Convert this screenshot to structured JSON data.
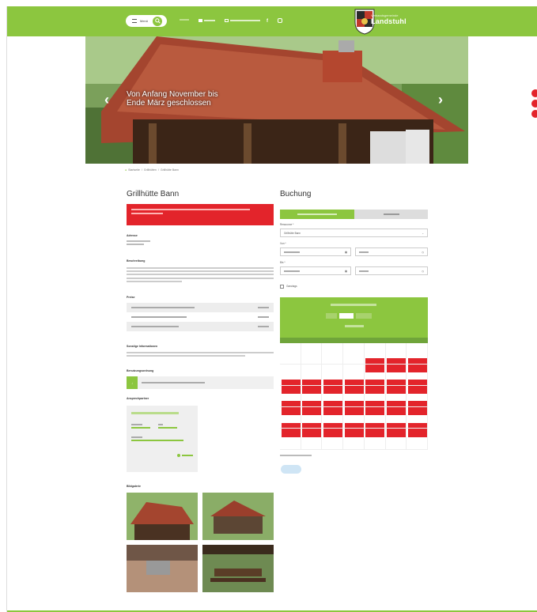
{
  "header": {
    "menu_label": "Menü",
    "nav_items": [
      "Menü",
      "",
      "",
      ""
    ],
    "logo_line1": "Verbandsgemeinde",
    "logo_line2": "Landstuhl"
  },
  "hero": {
    "caption": "Von Anfang November bis Ende März geschlossen",
    "prev": "‹",
    "next": "›"
  },
  "breadcrumb": [
    "Startseite",
    "Grillhütten",
    "Grillhütte Bann"
  ],
  "left": {
    "title": "Grillhütte Bann",
    "alert": "",
    "sections": {
      "address_label": "Adresse",
      "description_label": "Beschreibung",
      "prices_label": "Preise",
      "more_info_label": "Sonstige Informationen",
      "usage_rules_label": "Benutzungsordnung",
      "contact_label": "Ansprechpartner",
      "gallery_label": "Bildgalerie"
    },
    "prices": []
  },
  "booking": {
    "title": "Buchung",
    "tabs": [
      "",
      ""
    ],
    "resource_label": "Ressource *",
    "resource_value": "Grillhütte Bann",
    "from_label": "Von *",
    "to_label": "Bis *",
    "ganztags_label": "Ganztags",
    "submit": ""
  },
  "colors": {
    "accent": "#8cc63f",
    "alert": "#e3242b",
    "submit": "#cfe5f5"
  }
}
